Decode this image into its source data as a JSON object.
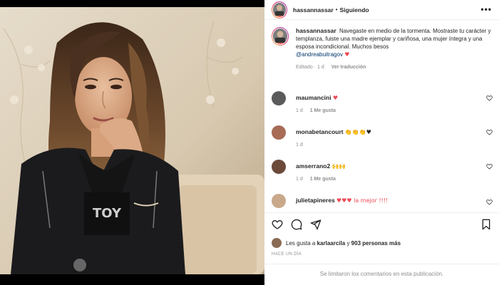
{
  "post": {
    "author": "hassannassar",
    "separator": "•",
    "follow_label": "Siguiendo",
    "more_label": "•••"
  },
  "caption": {
    "author": "hassannassar",
    "text": "Navegaste en medio de la tormenta. Mostraste tu carácter y templanza, fuiste una madre ejemplar y cariñosa, una mujer íntegra y una esposa incondicional. Muchos besos",
    "mention": "@andreabuitragov",
    "emoji": "♥",
    "edited": "Editado",
    "time": "1 d",
    "translate": "Ver traducción"
  },
  "comments": [
    {
      "user": "maumancini",
      "text": "♥",
      "time": "1 d",
      "likes": "1 Me gusta",
      "avatar_color": "#5b5b5b"
    },
    {
      "user": "monabetancourt",
      "text": "👏👏👏♥",
      "time": "1 d",
      "likes": "",
      "avatar_color": "#a86b55"
    },
    {
      "user": "amserrano2",
      "text": "🙌🙌",
      "time": "1 d",
      "likes": "1 Me gusta",
      "avatar_color": "#6b4a3a"
    },
    {
      "user": "julietapineres",
      "text": "♥♥♥ la mejor !!!!",
      "time": "",
      "likes": "",
      "avatar_color": "#c9a98a"
    }
  ],
  "actions": {
    "likes_prefix": "Les gusta a",
    "liker": "karlaarcila",
    "and": "y",
    "count": "903 personas más",
    "time_ago": "HACE UN DÍA",
    "comments_limited": "Se limitaron los comentarios en esta publicación."
  },
  "colors": {
    "heart": "#ed4956",
    "link": "#00376b",
    "muted": "#8e8e8e"
  },
  "icons": [
    "like-heart-icon",
    "comment-icon",
    "share-icon",
    "save-bookmark-icon",
    "small-heart-icon",
    "more-options-icon"
  ]
}
